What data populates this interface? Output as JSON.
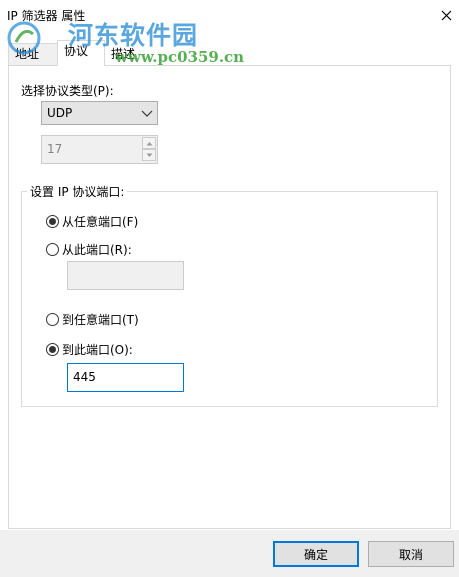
{
  "window": {
    "title": "IP 筛选器 属性",
    "close_icon": "close-icon"
  },
  "watermark": {
    "text": "河东软件园",
    "url": "www.pc0359.cn",
    "color": "#2b8fd6"
  },
  "tabs": [
    {
      "label": "地址",
      "active": false
    },
    {
      "label": "协议",
      "active": true
    },
    {
      "label": "描述",
      "active": false
    }
  ],
  "protocol": {
    "type_label": "选择协议类型(P):",
    "selected": "UDP",
    "number": "17"
  },
  "ports": {
    "group_label": "设置 IP 协议端口:",
    "from_any_label": "从任意端口(F)",
    "from_any_checked": true,
    "from_this_label": "从此端口(R):",
    "from_this_checked": false,
    "from_port_value": "",
    "to_any_label": "到任意端口(T)",
    "to_any_checked": false,
    "to_this_label": "到此端口(O):",
    "to_this_checked": true,
    "to_port_value": "445"
  },
  "buttons": {
    "ok": "确定",
    "cancel": "取消"
  },
  "colors": {
    "accent": "#0078d7",
    "footer_bg": "#f0f0f0"
  }
}
